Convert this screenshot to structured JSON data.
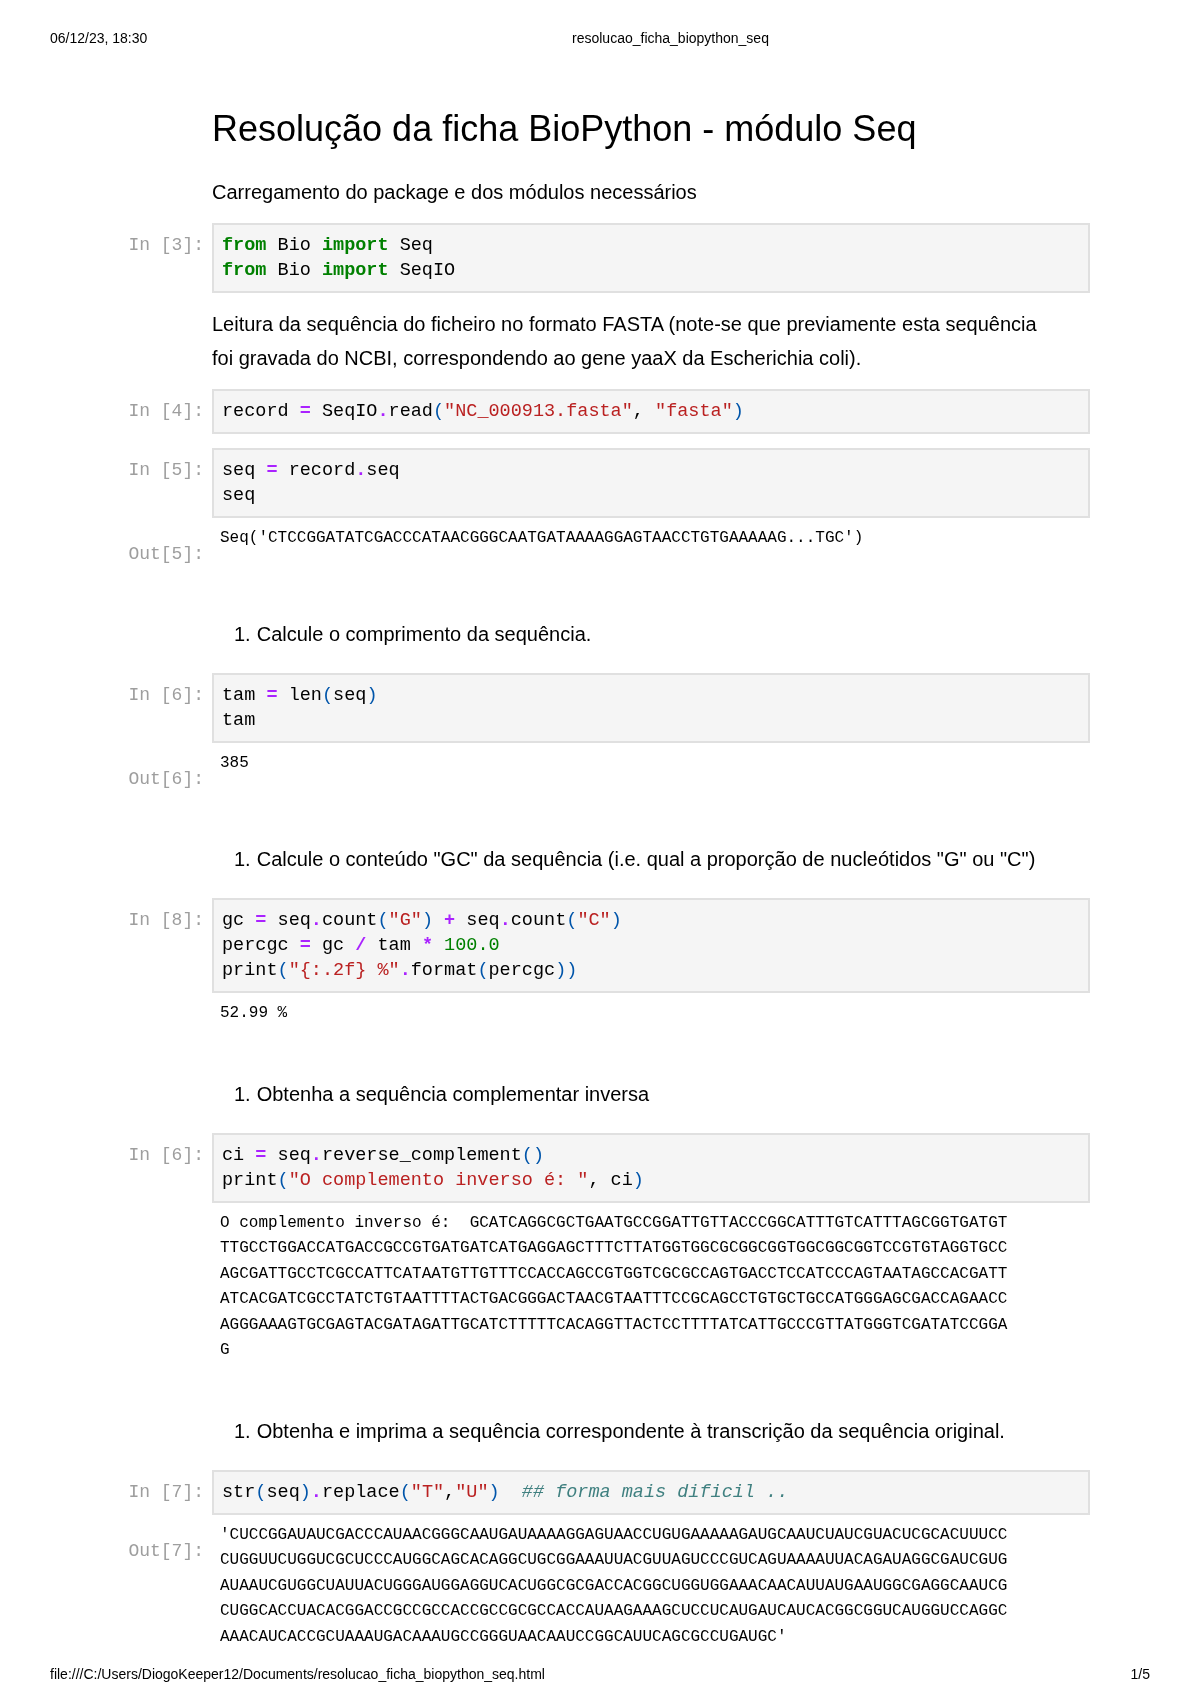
{
  "header": {
    "date": "06/12/23, 18:30",
    "title": "resolucao_ficha_biopython_seq"
  },
  "cells": [
    {
      "kind": "heading",
      "text": "Resolução da ficha BioPython - módulo Seq"
    },
    {
      "kind": "text",
      "text": "Carregamento do package e dos módulos necessários"
    },
    {
      "kind": "code",
      "prompt": "In [3]:",
      "lines": [
        [
          {
            "kind": "kw",
            "text": "from"
          },
          {
            "kind": "name",
            "text": " Bio "
          },
          {
            "kind": "kw",
            "text": "import"
          },
          {
            "kind": "name",
            "text": " Seq"
          }
        ],
        [
          {
            "kind": "kw",
            "text": "from"
          },
          {
            "kind": "name",
            "text": " Bio "
          },
          {
            "kind": "kw",
            "text": "import"
          },
          {
            "kind": "name",
            "text": " SeqIO"
          }
        ]
      ]
    },
    {
      "kind": "text",
      "text": "Leitura da sequência do ficheiro no formato FASTA (note-se que previamente esta sequência foi gravada do NCBI, correspondendo ao gene yaaX da Escherichia coli)."
    },
    {
      "kind": "code",
      "prompt": "In [4]:",
      "lines": [
        [
          {
            "kind": "name",
            "text": "record "
          },
          {
            "kind": "op",
            "text": "="
          },
          {
            "kind": "name",
            "text": " SeqIO"
          },
          {
            "kind": "op",
            "text": "."
          },
          {
            "kind": "name",
            "text": "read"
          },
          {
            "kind": "paren",
            "text": "("
          },
          {
            "kind": "str",
            "text": "\"NC_000913.fasta\""
          },
          {
            "kind": "name",
            "text": ", "
          },
          {
            "kind": "str",
            "text": "\"fasta\""
          },
          {
            "kind": "paren",
            "text": ")"
          }
        ]
      ]
    },
    {
      "kind": "code",
      "prompt": "In [5]:",
      "lines": [
        [
          {
            "kind": "name",
            "text": "seq "
          },
          {
            "kind": "op",
            "text": "="
          },
          {
            "kind": "name",
            "text": " record"
          },
          {
            "kind": "op",
            "text": "."
          },
          {
            "kind": "name",
            "text": "seq"
          }
        ],
        [
          {
            "kind": "name",
            "text": "seq"
          }
        ]
      ],
      "output": {
        "prompt": "Out[5]:",
        "lines": [
          "Seq('CTCCGGATATCGACCCATAACGGGCAATGATAAAAGGAGTAACCTGTGAAAAAG...TGC')"
        ]
      }
    },
    {
      "kind": "list",
      "number": "1.",
      "text": "Calcule o comprimento da sequência."
    },
    {
      "kind": "code",
      "prompt": "In [6]:",
      "lines": [
        [
          {
            "kind": "name",
            "text": "tam "
          },
          {
            "kind": "op",
            "text": "="
          },
          {
            "kind": "name",
            "text": " len"
          },
          {
            "kind": "paren",
            "text": "("
          },
          {
            "kind": "name",
            "text": "seq"
          },
          {
            "kind": "paren",
            "text": ")"
          }
        ],
        [
          {
            "kind": "name",
            "text": "tam"
          }
        ]
      ],
      "output": {
        "prompt": "Out[6]:",
        "lines": [
          "385"
        ]
      }
    },
    {
      "kind": "list",
      "number": "1.",
      "text": "Calcule o conteúdo \"GC\" da sequência (i.e. qual a proporção de nucleótidos \"G\" ou \"C\")"
    },
    {
      "kind": "code",
      "prompt": "In [8]:",
      "lines": [
        [
          {
            "kind": "name",
            "text": "gc "
          },
          {
            "kind": "op",
            "text": "="
          },
          {
            "kind": "name",
            "text": " seq"
          },
          {
            "kind": "op",
            "text": "."
          },
          {
            "kind": "name",
            "text": "count"
          },
          {
            "kind": "paren",
            "text": "("
          },
          {
            "kind": "str",
            "text": "\"G\""
          },
          {
            "kind": "paren",
            "text": ")"
          },
          {
            "kind": "op",
            "text": " +"
          },
          {
            "kind": "name",
            "text": " seq"
          },
          {
            "kind": "op",
            "text": "."
          },
          {
            "kind": "name",
            "text": "count"
          },
          {
            "kind": "paren",
            "text": "("
          },
          {
            "kind": "str",
            "text": "\"C\""
          },
          {
            "kind": "paren",
            "text": ")"
          }
        ],
        [
          {
            "kind": "name",
            "text": "percgc "
          },
          {
            "kind": "op",
            "text": "="
          },
          {
            "kind": "name",
            "text": " gc "
          },
          {
            "kind": "op",
            "text": "/"
          },
          {
            "kind": "name",
            "text": " tam "
          },
          {
            "kind": "op",
            "text": "*"
          },
          {
            "kind": "num",
            "text": " 100.0"
          }
        ],
        [
          {
            "kind": "name",
            "text": "print"
          },
          {
            "kind": "paren",
            "text": "("
          },
          {
            "kind": "str",
            "text": "\"{:.2f} %\""
          },
          {
            "kind": "op",
            "text": "."
          },
          {
            "kind": "name",
            "text": "format"
          },
          {
            "kind": "paren",
            "text": "("
          },
          {
            "kind": "name",
            "text": "percgc"
          },
          {
            "kind": "paren",
            "text": "))"
          }
        ]
      ],
      "output": {
        "lines": [
          "52.99 %"
        ]
      }
    },
    {
      "kind": "list",
      "number": "1.",
      "text": "Obtenha a sequência complementar inversa"
    },
    {
      "kind": "code",
      "prompt": "In [6]:",
      "lines": [
        [
          {
            "kind": "name",
            "text": "ci "
          },
          {
            "kind": "op",
            "text": "="
          },
          {
            "kind": "name",
            "text": " seq"
          },
          {
            "kind": "op",
            "text": "."
          },
          {
            "kind": "name",
            "text": "reverse_complement"
          },
          {
            "kind": "paren",
            "text": "()"
          }
        ],
        [
          {
            "kind": "name",
            "text": "print"
          },
          {
            "kind": "paren",
            "text": "("
          },
          {
            "kind": "str",
            "text": "\"O complemento inverso é: \""
          },
          {
            "kind": "name",
            "text": ", ci"
          },
          {
            "kind": "paren",
            "text": ")"
          }
        ]
      ],
      "output": {
        "lines": [
          "O complemento inverso é:  GCATCAGGCGCTGAATGCCGGATTGTTACCCGGCATTTGTCATTTAGCGGTGATGT",
          "TTGCCTGGACCATGACCGCCGTGATGATCATGAGGAGCTTTCTTATGGTGGCGCGGCGGTGGCGGCGGTCCGTGTAGGTGCC",
          "AGCGATTGCCTCGCCATTCATAATGTTGTTTCCACCAGCCGTGGTCGCGCCAGTGACCTCCATCCCAGTAATAGCCACGATT",
          "ATCACGATCGCCTATCTGTAATTTTACTGACGGGACTAACGTAATTTCCGCAGCCTGTGCTGCCATGGGAGCGACCAGAACC",
          "AGGGAAAGTGCGAGTACGATAGATTGCATCTTTTTCACAGGTTACTCCTTTTATCATTGCCCGTTATGGGTCGATATCCGGA",
          "G"
        ]
      }
    },
    {
      "kind": "list",
      "number": "1.",
      "text": "Obtenha e imprima a sequência correspondente à transcrição da sequência original."
    },
    {
      "kind": "code",
      "prompt": "In [7]:",
      "lines": [
        [
          {
            "kind": "name",
            "text": "str"
          },
          {
            "kind": "paren",
            "text": "("
          },
          {
            "kind": "name",
            "text": "seq"
          },
          {
            "kind": "paren",
            "text": ")"
          },
          {
            "kind": "op",
            "text": "."
          },
          {
            "kind": "name",
            "text": "replace"
          },
          {
            "kind": "paren",
            "text": "("
          },
          {
            "kind": "str",
            "text": "\"T\""
          },
          {
            "kind": "name",
            "text": ","
          },
          {
            "kind": "str",
            "text": "\"U\""
          },
          {
            "kind": "paren",
            "text": ")"
          },
          {
            "kind": "comment",
            "text": "  ## forma mais dificil .."
          }
        ]
      ],
      "output": {
        "prompt": "Out[7]:",
        "lines": [
          "'CUCCGGAUAUCGACCCAUAACGGGCAAUGAUAAAAGGAGUAACCUGUGAAAAAGAUGCAAUCUAUCGUACUCGCACUUUCC",
          "CUGGUUCUGGUCGCUCCCAUGGCAGCACAGGCUGCGGAAAUUACGUUAGUCCCGUCAGUAAAAUUACAGAUAGGCGAUCGUG",
          "AUAAUCGUGGCUAUUACUGGGAUGGAGGUCACUGGCGCGACCACGGCUGGUGGAAACAACAUUAUGAAUGGCGAGGCAAUCG",
          "CUGGCACCUACACGGACCGCCGCCACCGCCGCGCCACCAUAAGAAAGCUCCUCAUGAUCAUCACGGCGGUCAUGGUCCAGGC",
          "AAACAUCACCGCUAAAUGACAAAUGCCGGGUAACAAUCCGGCAUUCAGCGCCUGAUGC'"
        ]
      }
    }
  ],
  "footer": {
    "path": "file:///C:/Users/DiogoKeeper12/Documents/resolucao_ficha_biopython_seq.html",
    "page": "1/5"
  }
}
